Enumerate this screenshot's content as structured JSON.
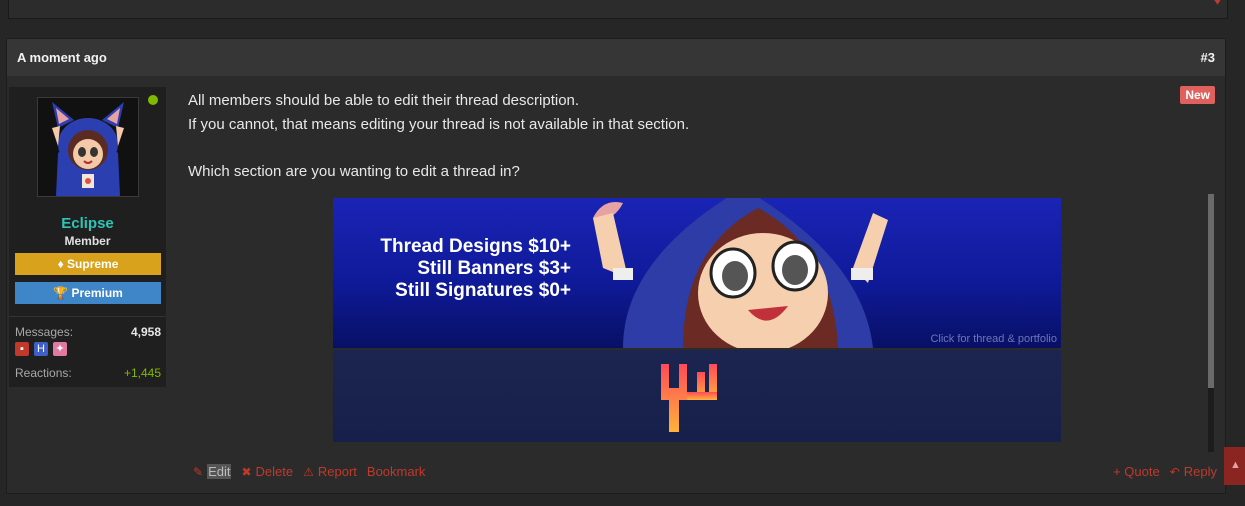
{
  "post": {
    "time": "A moment ago",
    "number": "#3",
    "new_badge": "New",
    "body": [
      "All members should be able to edit their thread description.",
      "If you cannot, that means editing your thread is not available in that section.",
      "",
      "Which section are you wanting to edit a thread in?"
    ]
  },
  "user": {
    "name": "Eclipse",
    "title": "Member",
    "banners": [
      "Supreme",
      "Premium"
    ],
    "stats": {
      "messages_label": "Messages:",
      "messages_value": "4,958",
      "reactions_label": "Reactions:",
      "reactions_value": "+1,445"
    },
    "online": true
  },
  "signature": {
    "lines": [
      "Thread Designs  $10+",
      "Still Banners  $3+",
      "Still Signatures  $0+"
    ],
    "click_text": "Click for thread  & portfolio"
  },
  "actions": {
    "edit": "Edit",
    "delete": "Delete",
    "report": "Report",
    "bookmark": "Bookmark",
    "quote": "+ Quote",
    "reply": "Reply"
  },
  "colors": {
    "username": "#2ec4b6",
    "supreme": "#d9a21c",
    "premium": "#3f86c8",
    "action": "#c0392b",
    "reactions": "#7fba00",
    "new_badge": "#e0605e"
  },
  "icons": {
    "edit": "pencil-icon",
    "delete": "x-icon",
    "report": "warning-icon",
    "reply": "reply-arrow-icon",
    "supreme": "diamond-icon",
    "premium": "trophy-icon"
  }
}
